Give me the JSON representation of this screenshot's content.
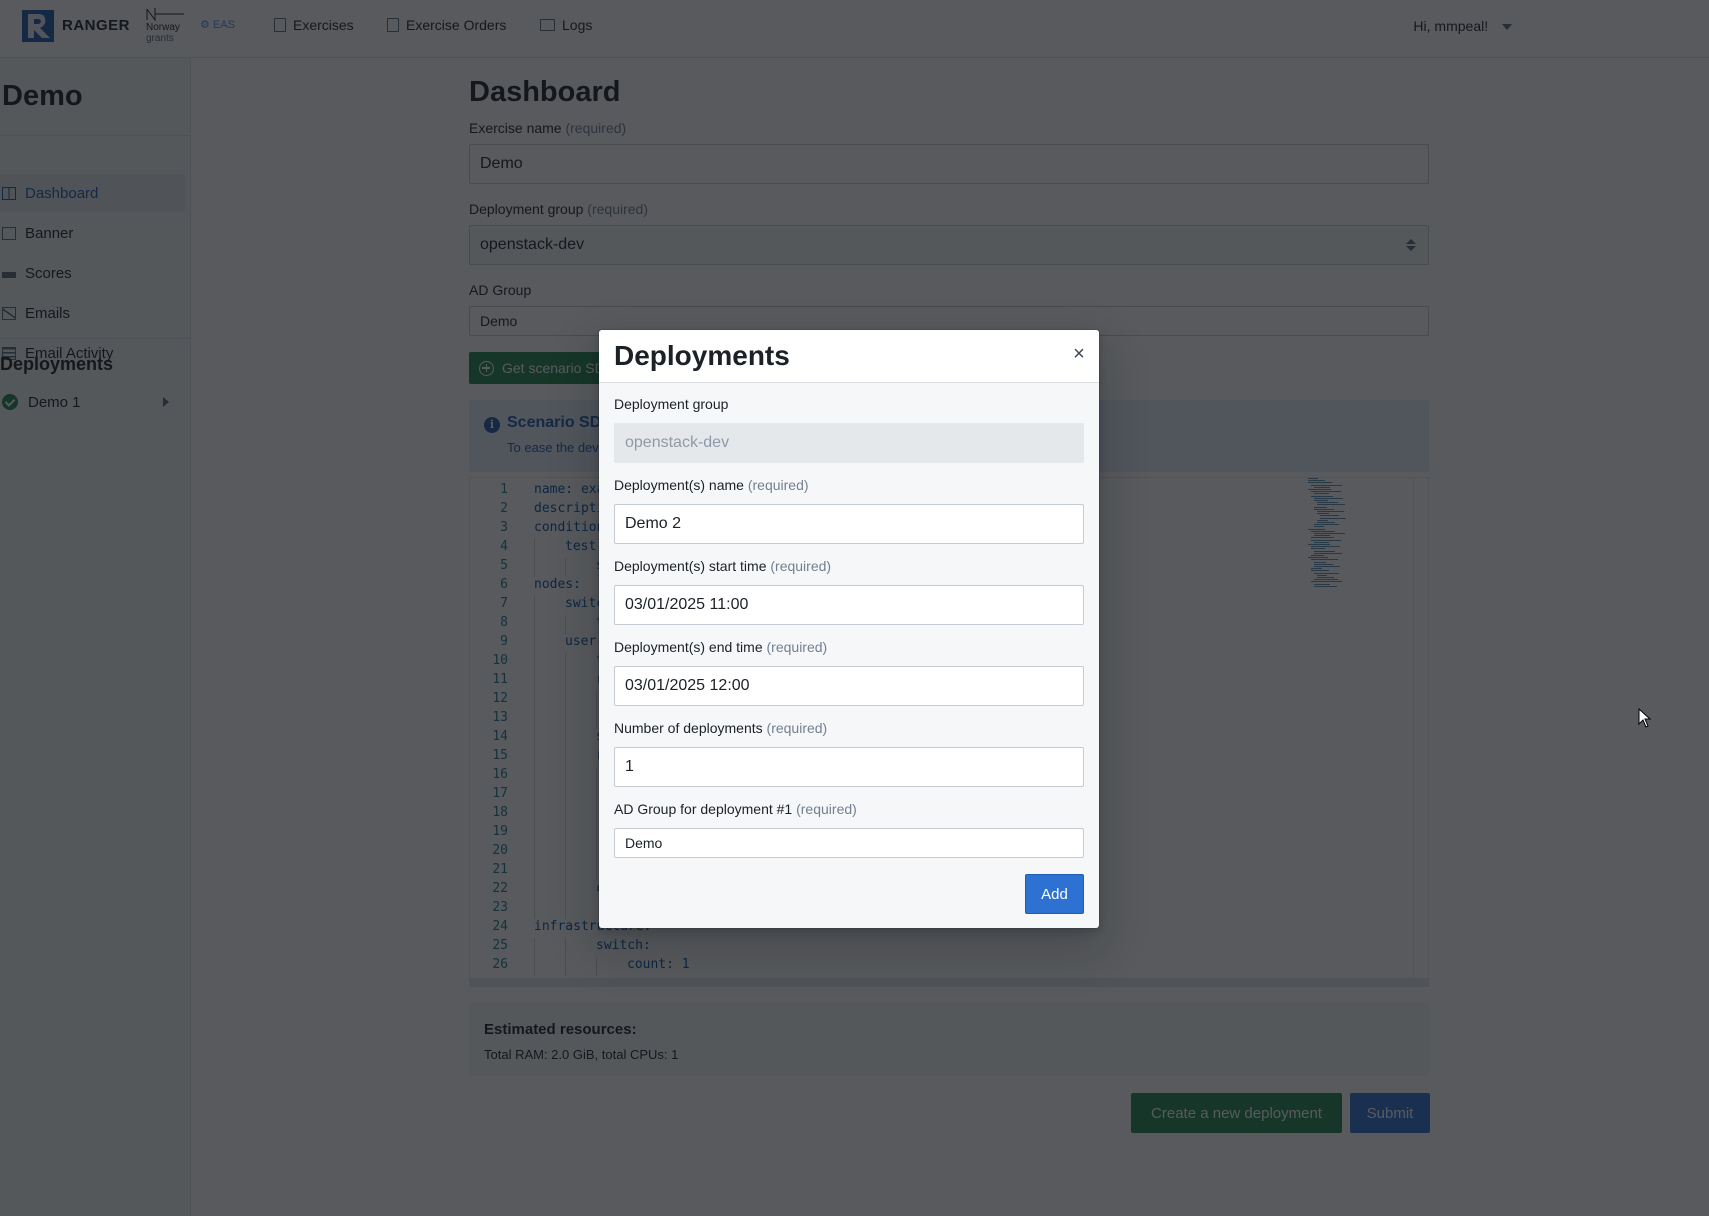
{
  "navbar": {
    "brand": "RANGER",
    "partner_logo_1_line1": "Norway",
    "partner_logo_1_line2": "grants",
    "partner_logo_2": "EAS",
    "links": [
      {
        "label": "Exercises",
        "icon": "file-icon"
      },
      {
        "label": "Exercise Orders",
        "icon": "document-share-icon"
      },
      {
        "label": "Logs",
        "icon": "manual-icon"
      }
    ],
    "user_greeting": "Hi, mmpeal!"
  },
  "sidebar": {
    "title": "Demo",
    "items": [
      {
        "label": "Dashboard",
        "icon": "dashboard-icon",
        "active": true
      },
      {
        "label": "Banner",
        "icon": "banner-icon",
        "active": false
      },
      {
        "label": "Scores",
        "icon": "scores-chart-icon",
        "active": false
      },
      {
        "label": "Emails",
        "icon": "envelope-icon",
        "active": false
      },
      {
        "label": "Email Activity",
        "icon": "list-icon",
        "active": false
      }
    ],
    "deployments_heading": "Deployments",
    "deployments": [
      {
        "label": "Demo 1",
        "status": "success"
      }
    ]
  },
  "main": {
    "title": "Dashboard",
    "required_suffix": "(required)",
    "exercise_name_label": "Exercise name",
    "exercise_name_value": "Demo",
    "deployment_group_label": "Deployment group",
    "deployment_group_value": "openstack-dev",
    "ad_group_label": "AD Group",
    "ad_group_value": "Demo",
    "get_sdl_button": "Get scenario SDL",
    "callout_title": "Scenario SDL",
    "callout_text": "To ease the development...",
    "editor_lines": [
      {
        "n": "1",
        "indent": 0,
        "text": "name: exa"
      },
      {
        "n": "2",
        "indent": 0,
        "text": "descripti"
      },
      {
        "n": "3",
        "indent": 0,
        "text": "condition"
      },
      {
        "n": "4",
        "indent": 1,
        "text": "test-"
      },
      {
        "n": "5",
        "indent": 2,
        "text": "s"
      },
      {
        "n": "6",
        "indent": 0,
        "text": "nodes:"
      },
      {
        "n": "7",
        "indent": 1,
        "text": "switc"
      },
      {
        "n": "8",
        "indent": 2,
        "text": "t"
      },
      {
        "n": "9",
        "indent": 1,
        "text": "user-"
      },
      {
        "n": "10",
        "indent": 2,
        "text": "t"
      },
      {
        "n": "11",
        "indent": 2,
        "text": "r"
      },
      {
        "n": "12",
        "indent": 3,
        "text": ""
      },
      {
        "n": "13",
        "indent": 3,
        "text": ""
      },
      {
        "n": "14",
        "indent": 2,
        "text": "s"
      },
      {
        "n": "15",
        "indent": 2,
        "text": "r"
      },
      {
        "n": "16",
        "indent": 3,
        "text": ""
      },
      {
        "n": "17",
        "indent": 3,
        "text": ""
      },
      {
        "n": "18",
        "indent": 3,
        "text": ""
      },
      {
        "n": "19",
        "indent": 3,
        "text": ""
      },
      {
        "n": "20",
        "indent": 3,
        "text": ""
      },
      {
        "n": "21",
        "indent": 3,
        "text": ""
      },
      {
        "n": "22",
        "indent": 2,
        "text": "c"
      },
      {
        "n": "23",
        "indent": 2,
        "text": ""
      },
      {
        "n": "24",
        "indent": 0,
        "text": "infrastructure:"
      },
      {
        "n": "25",
        "indent": 2,
        "text": "switch:"
      },
      {
        "n": "26",
        "indent": 3,
        "text": "count: 1"
      }
    ],
    "resources_title": "Estimated resources:",
    "resources_text": "Total RAM: 2.0 GiB, total CPUs: 1",
    "create_deployment_button": "Create a new deployment",
    "submit_button": "Submit"
  },
  "modal": {
    "title": "Deployments",
    "close_symbol": "×",
    "deployment_group_label": "Deployment group",
    "deployment_group_value": "openstack-dev",
    "name_label": "Deployment(s) name",
    "name_value": "Demo 2",
    "start_label": "Deployment(s) start time",
    "start_value": "03/01/2025 11:00",
    "end_label": "Deployment(s) end time",
    "end_value": "03/01/2025 12:00",
    "count_label": "Number of deployments",
    "count_value": "1",
    "ad_group_label": "AD Group for deployment #1",
    "ad_group_value": "Demo",
    "required_suffix": "(required)",
    "add_button": "Add"
  },
  "colors": {
    "primary": "#2d72d2",
    "success": "#238551",
    "overlay": "rgba(17,20,24,0.7)"
  }
}
